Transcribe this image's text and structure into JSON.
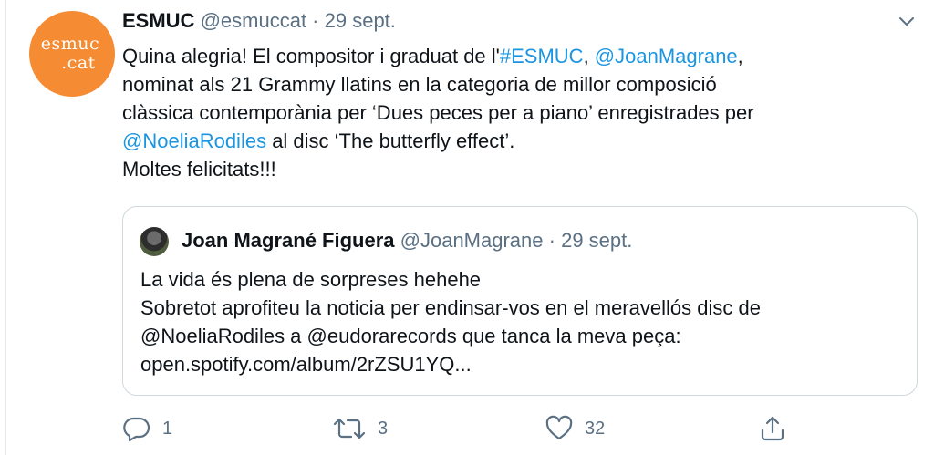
{
  "author": {
    "avatar_text_line1": "esmuc",
    "avatar_text_line2": ".cat",
    "name": "ESMUC",
    "handle": "@esmuccat",
    "separator": " · ",
    "date": "29 sept."
  },
  "tweet": {
    "line1_pre": "Quina alegria! El compositor i graduat de l'",
    "line1_hashtag": "#ESMUC",
    "line1_mid": ", ",
    "line1_mention": "@JoanMagrane",
    "line1_post": ",",
    "line2": "nominat als 21 Grammy llatins en la categoria de millor composició",
    "line3": "clàssica contemporània per ‘Dues peces per a piano’ enregistrades per",
    "line4_mention": "@NoeliaRodiles",
    "line4_post": " al disc ‘The butterfly effect’.",
    "line5": "Moltes felicitats!!!"
  },
  "quoted": {
    "name": "Joan Magrané Figuera",
    "handle": "@JoanMagrane",
    "separator": " · ",
    "date": "29 sept.",
    "lines": [
      "La vida és plena de sorpreses hehehe",
      "Sobretot aprofiteu la noticia per endinsar-vos en el meravellós disc de",
      "@NoeliaRodiles a @eudorarecords que tanca la meva peça:",
      "open.spotify.com/album/2rZSU1YQ..."
    ]
  },
  "actions": {
    "reply_count": "1",
    "retweet_count": "3",
    "like_count": "32"
  },
  "icons": {
    "menu": "chevron-down-icon",
    "reply": "reply-icon",
    "retweet": "retweet-icon",
    "like": "heart-icon",
    "share": "share-icon"
  },
  "colors": {
    "link": "#1b95e0",
    "avatar_bg": "#f58b32",
    "secondary_text": "#5b7083",
    "border": "#cfd9de"
  }
}
